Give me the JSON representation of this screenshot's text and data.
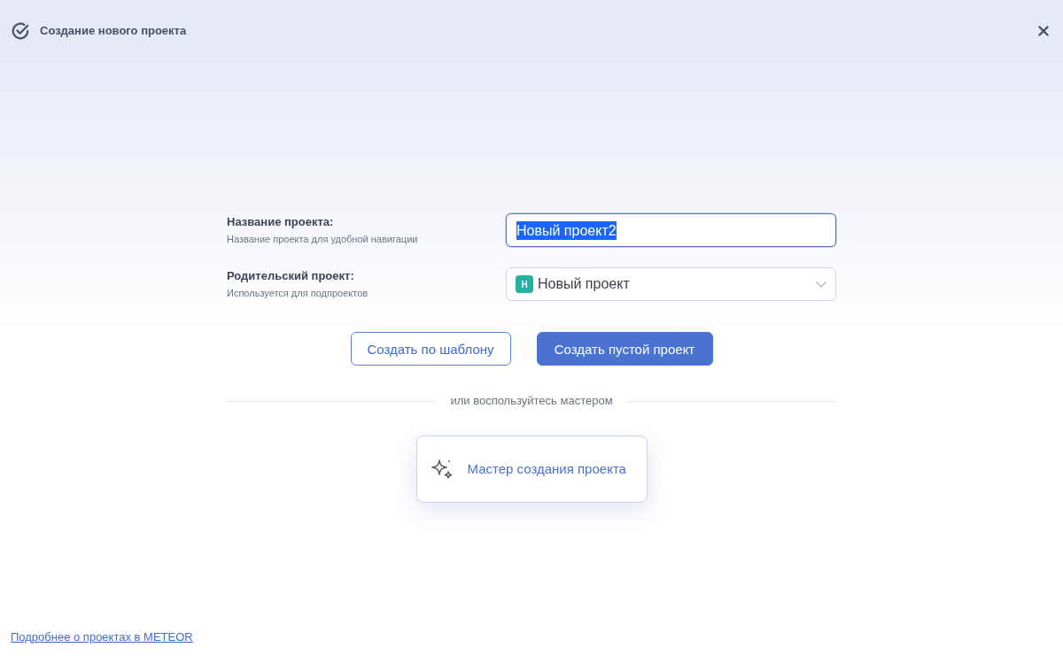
{
  "window": {
    "title": "Создание нового проекта"
  },
  "name_field": {
    "label": "Название проекта:",
    "hint": "Название проекта для удобной навигации",
    "value": "Новый проект2",
    "focused": true,
    "text_selected": true
  },
  "parent_field": {
    "label": "Родительский проект:",
    "hint": "Используется для подпроектов",
    "badge": "Н",
    "color": "#26b0a0",
    "value": "Новый проект"
  },
  "buttons": [
    {
      "label": "Создать по шаблону",
      "kind": "outline"
    },
    {
      "label": "Создать пустой проект",
      "kind": "primary"
    }
  ],
  "divider_text": "или воспользуйтесь мастером",
  "wizard_button": {
    "label": "Мастер создания проекта"
  },
  "footer_link": "Подробнее о проектах в METEOR"
}
